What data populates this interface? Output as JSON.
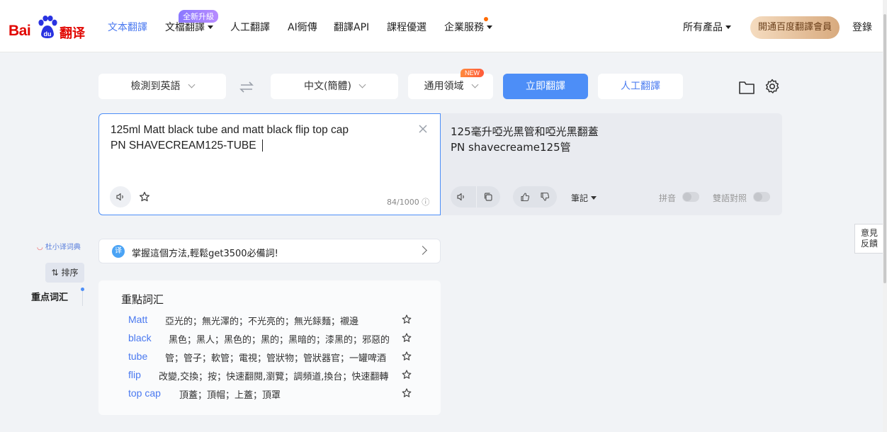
{
  "header": {
    "logo_text_bai": "Bai",
    "logo_text_du": "du",
    "logo_text_fanyi": "翻译",
    "nav": [
      {
        "label": "文本翻譯",
        "active": true
      },
      {
        "label": "文檔翻譯",
        "dropdown": true,
        "badge": "全新升級"
      },
      {
        "label": "人工翻譯"
      },
      {
        "label": "AI衕傳"
      },
      {
        "label": "翻譯API"
      },
      {
        "label": "課程優選"
      },
      {
        "label": "企業服務",
        "dropdown": true,
        "dot": true
      }
    ],
    "all_products": "所有產品",
    "vip_button": "開通百度翻譯會員",
    "login": "登錄"
  },
  "toolbar": {
    "source_lang": "檢測到英語",
    "target_lang": "中文(簡體)",
    "domain": "通用領域",
    "domain_badge": "NEW",
    "translate_button": "立即翻譯",
    "human_button": "人工翻譯"
  },
  "source": {
    "line1": "125ml Matt black tube and matt black flip top cap",
    "line2": "PN SHAVECREAM125-TUBE",
    "char_count": "84/1000"
  },
  "target": {
    "line1": "125毫升啞光黑管和啞光黑翻蓋",
    "line2": "PN shavecreame125管",
    "notes": "筆記",
    "pinyin": "拼音",
    "bilingual": "雙語對照"
  },
  "rail": {
    "dict_logo": "杜小译词典",
    "sort_button": "排序",
    "key_words_label": "重点词汇"
  },
  "tip": {
    "icon_text": "译",
    "text": "掌握這個方法,輕鬆get3500必備詞!"
  },
  "key_words": {
    "title": "重點詞汇",
    "items": [
      {
        "word": "Matt",
        "definition": "亞光的；無光澤的；不光亮的；無光銾麵；襯邊"
      },
      {
        "word": "black",
        "definition": "黑色；黑人；黑色的；黑的；黑暗的；漆黑的；邪惡的"
      },
      {
        "word": "tube",
        "definition": "管；管子；軟管；電視；管狀物；管狀器官；一罐啤酒"
      },
      {
        "word": "flip",
        "definition": "改變,交換；按；快速翻閱,瀏覽；調頻道,換台；快速翻轉"
      },
      {
        "word": "top cap",
        "definition": "頂蓋；頂帽；上蓋；頂罩"
      }
    ]
  },
  "feedback": {
    "line1": "意見",
    "line2": "反饋"
  },
  "colors": {
    "accent": "#4d8ef7",
    "brand_red": "#e10601"
  }
}
